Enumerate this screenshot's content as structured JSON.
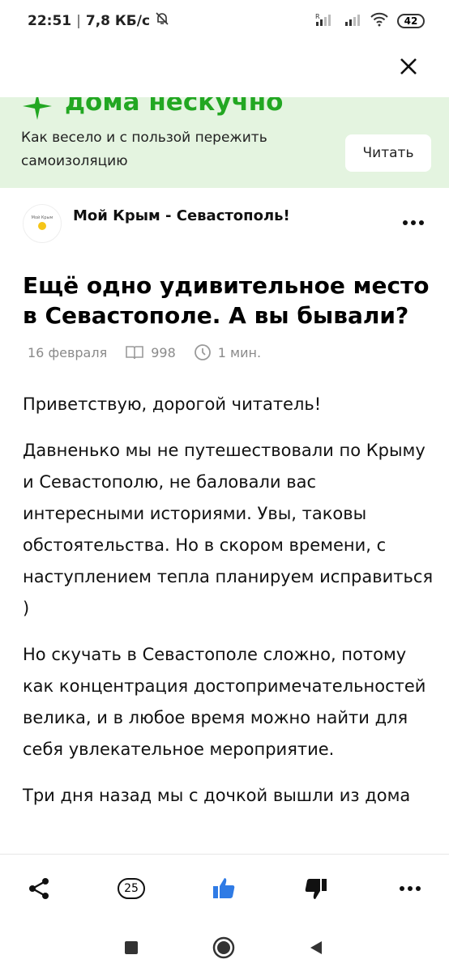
{
  "status_bar": {
    "time": "22:51",
    "speed": "7,8 КБ/с",
    "battery": "42",
    "network_label": "R"
  },
  "promo": {
    "title": "дома нескучно",
    "text": "Как весело и с пользой пережить самоизоляцию",
    "button": "Читать",
    "accent_color": "#22a722",
    "background": "#e4f4e0"
  },
  "channel": {
    "name": "Мой Крым - Севастополь!",
    "avatar_text": "Мой Крым"
  },
  "article": {
    "title": "Ещё одно удивительное место в Севастополе. А вы бывали?",
    "date": "16 февраля",
    "views": "998",
    "read_time": "1 мин.",
    "paragraphs": [
      "Приветствую, дорогой читатель!",
      "Давненько мы не путешествовали по Крыму и Севастополю, не баловали вас интересными историями. Увы, таковы обстоятельства. Но в скором времени, с наступлением тепла планируем исправиться )",
      "Но скучать в Севастополе сложно, потому как концентрация достопримечательностей велика, и в любое время можно найти для себя увлекательное мероприятие.",
      "Три дня назад мы с дочкой вышли из дома"
    ]
  },
  "actions": {
    "comments": "25",
    "like_color": "#2f7be5"
  },
  "icons": [
    "silent-bell-icon",
    "signal-icon",
    "wifi-icon",
    "close-icon",
    "more-icon",
    "views-icon",
    "clock-icon",
    "share-icon",
    "comments-icon",
    "like-icon",
    "dislike-icon",
    "square-icon",
    "circle-icon",
    "back-icon"
  ]
}
